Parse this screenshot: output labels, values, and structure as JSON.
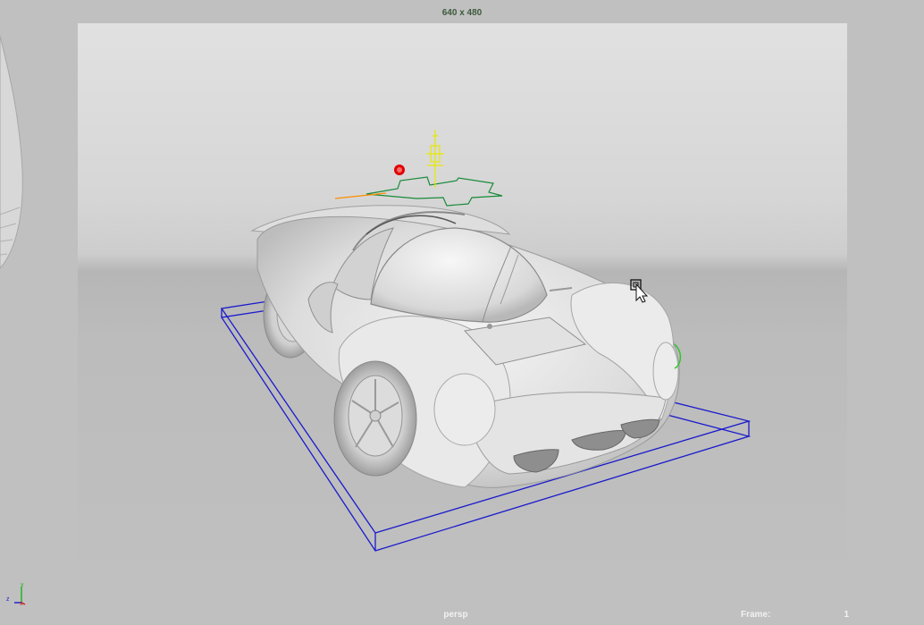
{
  "viewport": {
    "resolution_gate_label": "640 x 480",
    "camera_name": "persp",
    "frame_label": "Frame:",
    "frame_value": "1"
  },
  "axis_gizmo": {
    "x_label": "x",
    "y_label": "y",
    "z_label": "z"
  },
  "colors": {
    "background": "#c0c0c0",
    "gate_top": "#e1e1e1",
    "gate_horizon": "#b6b6b6",
    "bounding_box": "#1a1acc",
    "light_gizmo": "#e8e800",
    "ground_gizmo": "#1a8a3a",
    "selection_marker": "#e00000",
    "car_body": "#e6e6e6"
  }
}
